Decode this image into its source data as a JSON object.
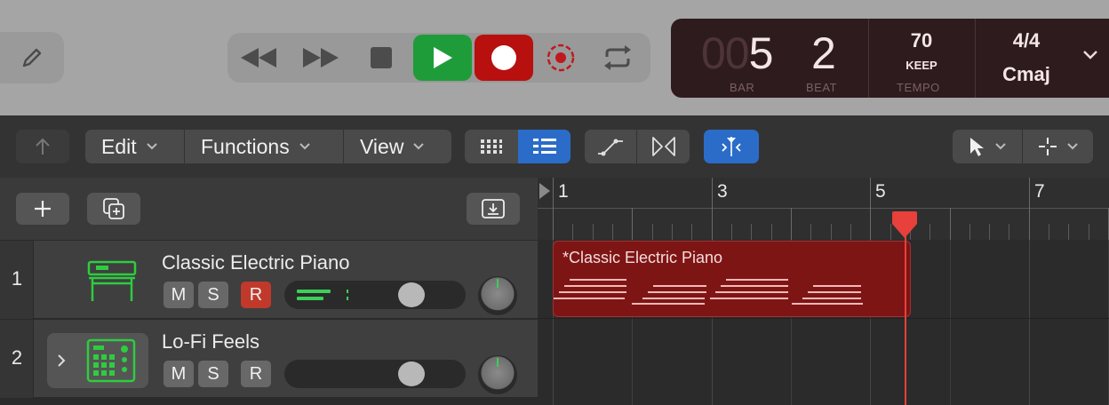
{
  "lcd": {
    "bar_dim": "00",
    "bar": "5",
    "beat": "2",
    "bar_label": "BAR",
    "beat_label": "BEAT",
    "tempo": "70",
    "tempo_mode": "KEEP",
    "tempo_label": "TEMPO",
    "time_signature": "4/4",
    "key": "Cmaj"
  },
  "toolbar": {
    "edit_label": "Edit",
    "functions_label": "Functions",
    "view_label": "View"
  },
  "ruler": {
    "bars": [
      "1",
      "3",
      "5",
      "7"
    ]
  },
  "tracks": [
    {
      "number": "1",
      "name": "Classic Electric Piano",
      "mute": "M",
      "solo": "S",
      "record": "R",
      "record_armed": true
    },
    {
      "number": "2",
      "name": "Lo-Fi Feels",
      "mute": "M",
      "solo": "S",
      "record": "R",
      "record_armed": false
    }
  ],
  "regions": [
    {
      "track": 1,
      "name": "*Classic Electric Piano",
      "start_bar": 1,
      "end_bar": 5.5
    }
  ],
  "playhead_bar": 5.4,
  "colors": {
    "play": "#1f9c3a",
    "record": "#b80f0f",
    "accent": "#2b6cc9",
    "region": "#7e1515",
    "instrument_icon": "#2ecc40"
  }
}
